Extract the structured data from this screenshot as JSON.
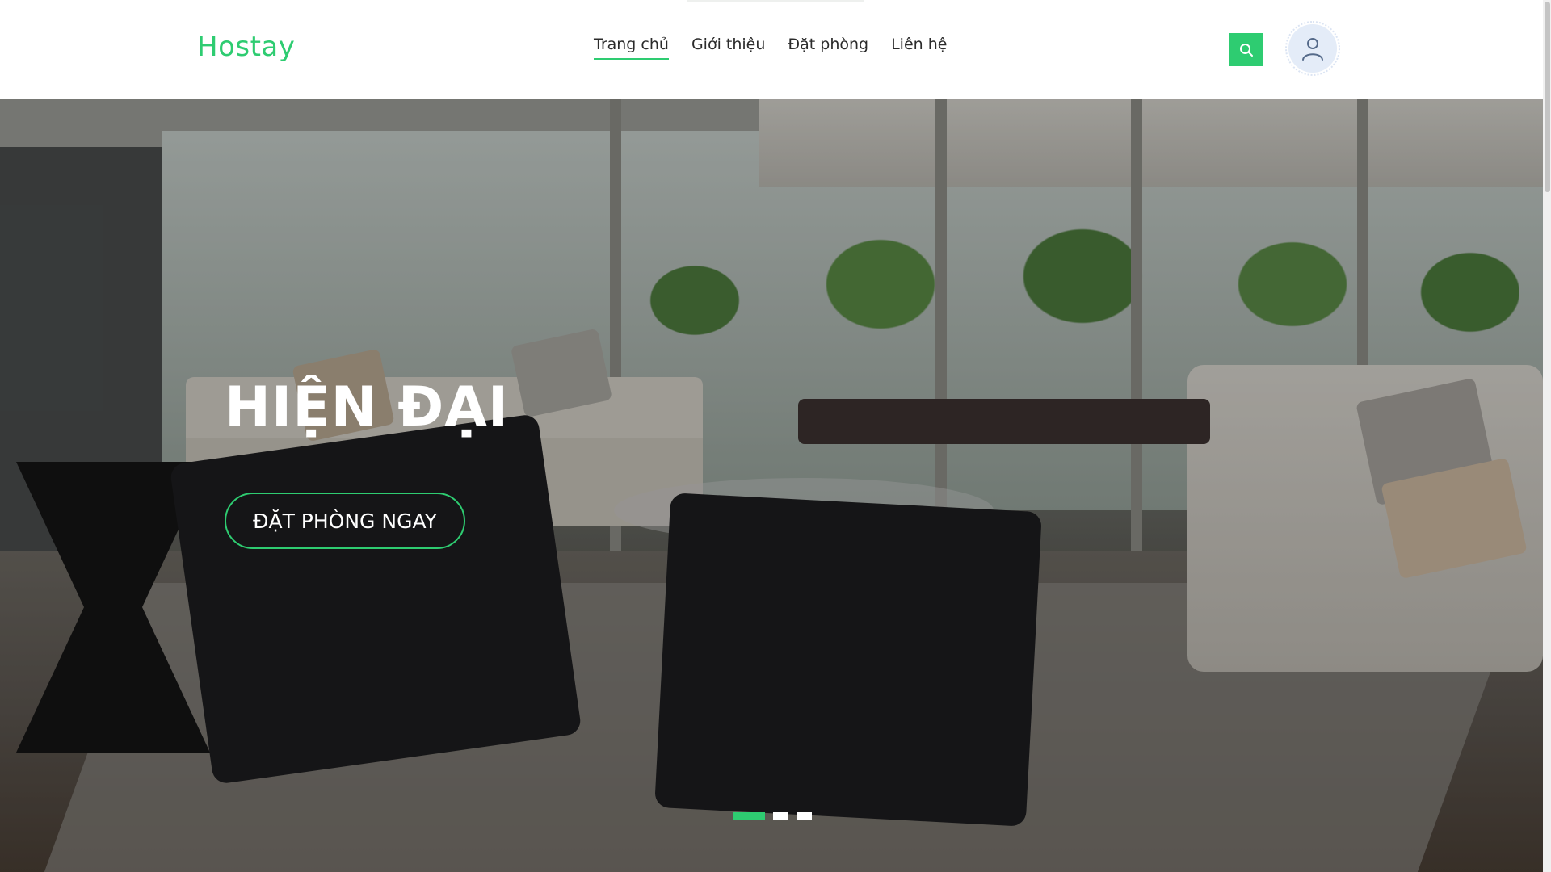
{
  "header": {
    "logo": "Hostay",
    "nav": [
      {
        "label": "Trang chủ",
        "active": true
      },
      {
        "label": "Giới thiệu",
        "active": false
      },
      {
        "label": "Đặt phòng",
        "active": false
      },
      {
        "label": "Liên hệ",
        "active": false
      }
    ],
    "search_icon": "search-icon",
    "avatar_icon": "user-icon"
  },
  "hero": {
    "title": "HIỆN ĐẠI",
    "cta_label": "ĐẶT PHÒNG NGAY",
    "slides": {
      "count": 3,
      "active_index": 0
    }
  },
  "colors": {
    "accent": "#2ecc71",
    "text": "#2b2b2b",
    "header_bg": "#ffffff"
  }
}
